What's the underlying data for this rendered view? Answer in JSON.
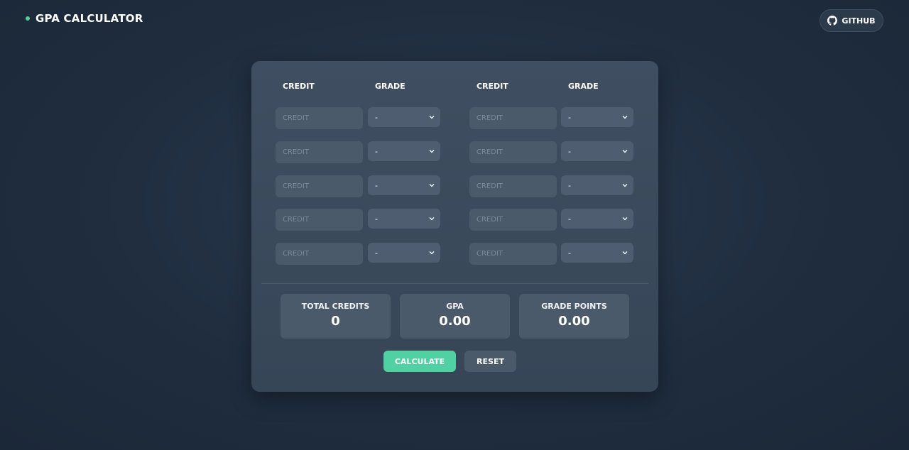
{
  "header": {
    "title": "GPA CALCULATOR",
    "github_label": "GITHUB"
  },
  "table": {
    "credit_header": "CREDIT",
    "grade_header": "GRADE",
    "credit_placeholder": "CREDIT",
    "rows": [
      {
        "left_grade": "-",
        "right_grade": "-"
      },
      {
        "left_grade": "-",
        "right_grade": "-"
      },
      {
        "left_grade": "-",
        "right_grade": "-"
      },
      {
        "left_grade": "-",
        "right_grade": "-"
      },
      {
        "left_grade": "-",
        "right_grade": "-"
      }
    ]
  },
  "stats": {
    "total_credits_label": "TOTAL CREDITS",
    "total_credits_value": "0",
    "gpa_label": "GPA",
    "gpa_value": "0.00",
    "grade_points_label": "GRADE POINTS",
    "grade_points_value": "0.00"
  },
  "actions": {
    "calculate_label": "CALCULATE",
    "reset_label": "RESET"
  },
  "colors": {
    "accent": "#4fd1a1",
    "background": "#1f2d3f",
    "card": "#3a4a5c"
  },
  "icons": {
    "brand": "dot-icon",
    "github": "github-icon",
    "select": "chevron-down-icon"
  }
}
